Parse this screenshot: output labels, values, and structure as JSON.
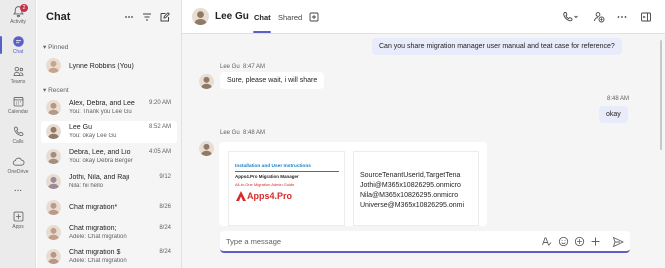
{
  "rail": {
    "items": [
      {
        "label": "Activity",
        "icon": "bell-icon",
        "badge": "2"
      },
      {
        "label": "Chat",
        "icon": "chat-icon",
        "active": true
      },
      {
        "label": "Teams",
        "icon": "teams-icon"
      },
      {
        "label": "Calendar",
        "icon": "calendar-icon"
      },
      {
        "label": "Calls",
        "icon": "phone-icon"
      },
      {
        "label": "OneDrive",
        "icon": "cloud-icon"
      },
      {
        "label": "...",
        "icon": "more-icon"
      },
      {
        "label": "Apps",
        "icon": "apps-icon"
      }
    ]
  },
  "chat_list": {
    "title": "Chat",
    "pinned_label": "Pinned",
    "recent_label": "Recent",
    "pinned": [
      {
        "name": "Lynne Robbins (You)",
        "avatar_color": "#c8a58a"
      }
    ],
    "recent": [
      {
        "name": "Alex, Debra, and Lee",
        "preview": "You: Thank you Lee Gu",
        "time": "9:20 AM",
        "avatar_color": "#b49a86"
      },
      {
        "name": "Lee Gu",
        "preview": "You: okay Lee Gu",
        "time": "8:52 AM",
        "avatar_color": "#8f7a66",
        "selected": true
      },
      {
        "name": "Debra, Lee, and Lio",
        "preview": "You: okay Debra Berger",
        "time": "4:05 AM",
        "avatar_color": "#a38f80"
      },
      {
        "name": "Jothi, Nila, and Raji",
        "preview": "Nila: hii hello",
        "time": "9/12",
        "avatar_color": "#9c8a9a"
      },
      {
        "name": "Chat migration*",
        "preview": "",
        "time": "8/26",
        "avatar_color": "#b99b88"
      },
      {
        "name": "Chat migration;",
        "preview": "Adele: Chat migration",
        "time": "8/24",
        "avatar_color": "#c29f8b"
      },
      {
        "name": "Chat migration $",
        "preview": "Adele: Chat migration",
        "time": "8/24",
        "avatar_color": "#b89783"
      }
    ]
  },
  "header": {
    "name": "Lee Gu",
    "tabs": [
      "Chat",
      "Shared"
    ],
    "active_tab": "Chat"
  },
  "messages": {
    "m1": {
      "text": "Can you share migration manager user manual and teat case for reference?"
    },
    "m2": {
      "author": "Lee Gu",
      "time": "8:47 AM",
      "text": "Sure, please wait, i will share"
    },
    "m3": {
      "time": "8:48 AM",
      "text": "okay"
    },
    "m4": {
      "author": "Lee Gu",
      "time": "8:48 AM"
    }
  },
  "attachments": {
    "doc": {
      "title": "Installation and User Instructions",
      "subtitle": "Apps4.Pro Migration Manager",
      "subtitle2": "All-in-One Migration Admin Guide",
      "logo_text": "Apps4.Pro"
    },
    "csv": {
      "lines": [
        "SourceTenantUserId,TargetTena",
        "Jothi@M365x10826295.onmicro",
        "Nila@M365x10826295.onmicro",
        "Universe@M365x10826295.onmi"
      ]
    }
  },
  "composer": {
    "placeholder": "Type a message"
  },
  "colors": {
    "accent": "#5b5fc7",
    "my_bubble": "#e8ebfa",
    "badge": "#c4314b",
    "logo_red": "#d62b2b"
  }
}
